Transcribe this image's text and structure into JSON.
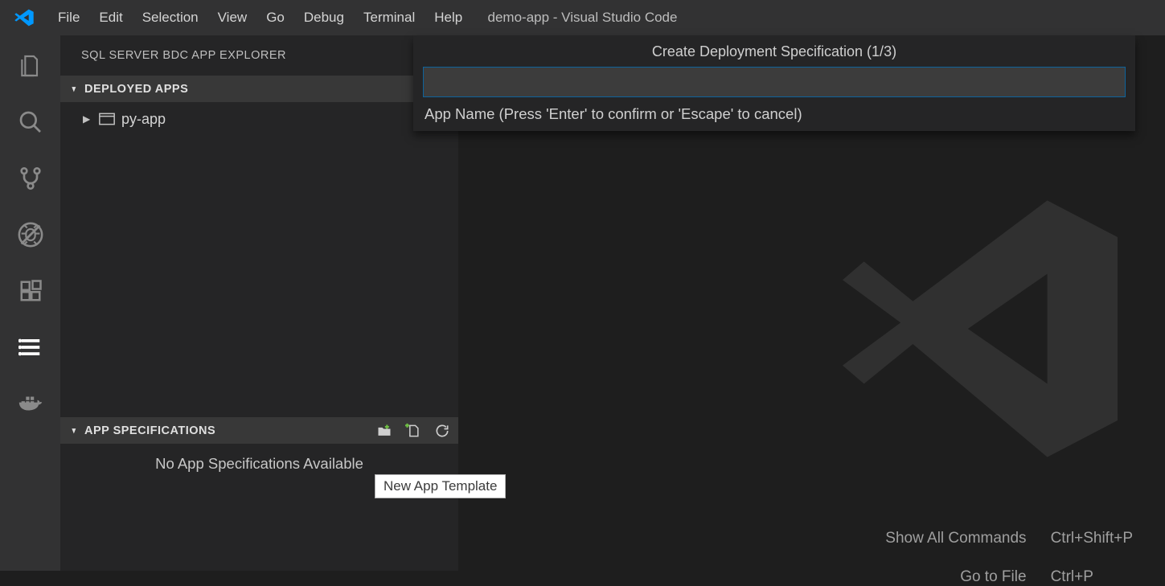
{
  "titlebar": {
    "title": "demo-app - Visual Studio Code",
    "menus": [
      "File",
      "Edit",
      "Selection",
      "View",
      "Go",
      "Debug",
      "Terminal",
      "Help"
    ]
  },
  "activitybar": {
    "items": [
      {
        "name": "explorer-icon"
      },
      {
        "name": "search-icon"
      },
      {
        "name": "source-control-icon"
      },
      {
        "name": "debug-icon"
      },
      {
        "name": "extensions-icon"
      },
      {
        "name": "sql-bdc-icon"
      },
      {
        "name": "docker-icon"
      }
    ]
  },
  "sidebar": {
    "title": "SQL SERVER BDC APP EXPLORER",
    "sections": {
      "deployed": {
        "header": "DEPLOYED APPS",
        "items": [
          {
            "label": "py-app"
          }
        ]
      },
      "specs": {
        "header": "APP SPECIFICATIONS",
        "empty_message": "No App Specifications Available",
        "action_tooltip": "New App Template"
      }
    }
  },
  "quickinput": {
    "title": "Create Deployment Specification (1/3)",
    "value": "",
    "hint": "App Name (Press 'Enter' to confirm or 'Escape' to cancel)"
  },
  "welcome": {
    "rows": [
      {
        "label": "Show All Commands",
        "key": "Ctrl+Shift+P"
      },
      {
        "label": "Go to File",
        "key": "Ctrl+P"
      }
    ]
  }
}
